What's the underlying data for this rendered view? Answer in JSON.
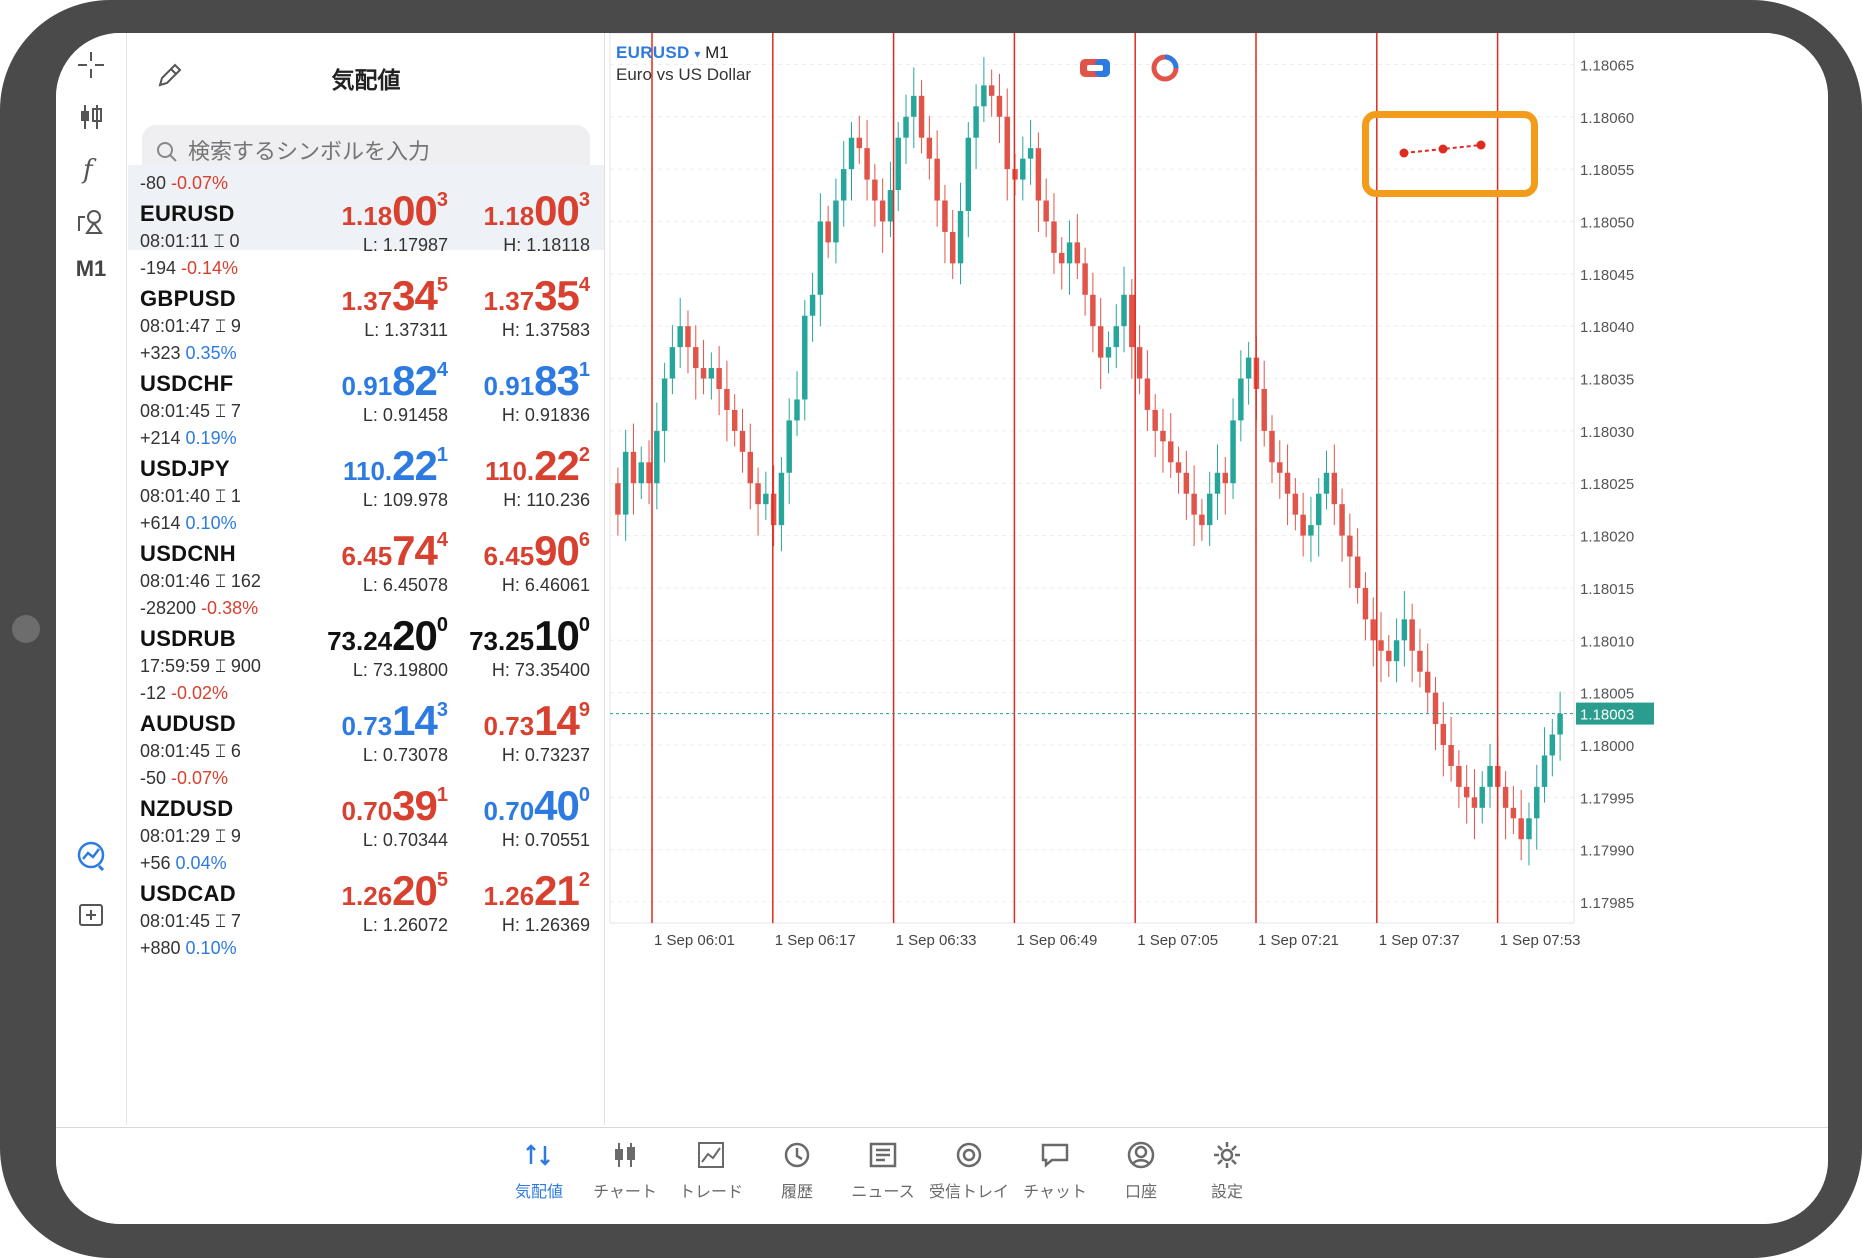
{
  "quotes": {
    "title": "気配値",
    "search_placeholder": "検索するシンボルを入力",
    "rows": [
      {
        "change": "-80",
        "pct": "-0.07%",
        "pct_color": "red",
        "symbol": "EURUSD",
        "time": "08:01:11",
        "spread": "0",
        "bid": {
          "a": "1.18",
          "b": "00",
          "c": "3",
          "color": "red"
        },
        "ask": {
          "a": "1.18",
          "b": "00",
          "c": "3",
          "color": "red"
        },
        "low": "L: 1.17987",
        "high": "H: 1.18118",
        "selected": true
      },
      {
        "change": "-194",
        "pct": "-0.14%",
        "pct_color": "red",
        "symbol": "GBPUSD",
        "time": "08:01:47",
        "spread": "9",
        "bid": {
          "a": "1.37",
          "b": "34",
          "c": "5",
          "color": "red"
        },
        "ask": {
          "a": "1.37",
          "b": "35",
          "c": "4",
          "color": "red"
        },
        "low": "L: 1.37311",
        "high": "H: 1.37583"
      },
      {
        "change": "+323",
        "pct": "0.35%",
        "pct_color": "blue",
        "symbol": "USDCHF",
        "time": "08:01:45",
        "spread": "7",
        "bid": {
          "a": "0.91",
          "b": "82",
          "c": "4",
          "color": "blue"
        },
        "ask": {
          "a": "0.91",
          "b": "83",
          "c": "1",
          "color": "blue"
        },
        "low": "L: 0.91458",
        "high": "H: 0.91836"
      },
      {
        "change": "+214",
        "pct": "0.19%",
        "pct_color": "blue",
        "symbol": "USDJPY",
        "time": "08:01:40",
        "spread": "1",
        "bid": {
          "a": "110.",
          "b": "22",
          "c": "1",
          "color": "blue"
        },
        "ask": {
          "a": "110.",
          "b": "22",
          "c": "2",
          "color": "red"
        },
        "low": "L: 109.978",
        "high": "H: 110.236"
      },
      {
        "change": "+614",
        "pct": "0.10%",
        "pct_color": "blue",
        "symbol": "USDCNH",
        "time": "08:01:46",
        "spread": "162",
        "bid": {
          "a": "6.45",
          "b": "74",
          "c": "4",
          "color": "red"
        },
        "ask": {
          "a": "6.45",
          "b": "90",
          "c": "6",
          "color": "red"
        },
        "low": "L: 6.45078",
        "high": "H: 6.46061"
      },
      {
        "change": "-28200",
        "pct": "-0.38%",
        "pct_color": "red",
        "symbol": "USDRUB",
        "time": "17:59:59",
        "spread": "900",
        "bid": {
          "a": "73.24",
          "b": "20",
          "c": "0",
          "color": "black"
        },
        "ask": {
          "a": "73.25",
          "b": "10",
          "c": "0",
          "color": "black"
        },
        "low": "L: 73.19800",
        "high": "H: 73.35400"
      },
      {
        "change": "-12",
        "pct": "-0.02%",
        "pct_color": "red",
        "symbol": "AUDUSD",
        "time": "08:01:45",
        "spread": "6",
        "bid": {
          "a": "0.73",
          "b": "14",
          "c": "3",
          "color": "blue"
        },
        "ask": {
          "a": "0.73",
          "b": "14",
          "c": "9",
          "color": "red"
        },
        "low": "L: 0.73078",
        "high": "H: 0.73237"
      },
      {
        "change": "-50",
        "pct": "-0.07%",
        "pct_color": "red",
        "symbol": "NZDUSD",
        "time": "08:01:29",
        "spread": "9",
        "bid": {
          "a": "0.70",
          "b": "39",
          "c": "1",
          "color": "red"
        },
        "ask": {
          "a": "0.70",
          "b": "40",
          "c": "0",
          "color": "blue"
        },
        "low": "L: 0.70344",
        "high": "H: 0.70551"
      },
      {
        "change": "+56",
        "pct": "0.04%",
        "pct_color": "blue",
        "symbol": "USDCAD",
        "time": "08:01:45",
        "spread": "7",
        "bid": {
          "a": "1.26",
          "b": "20",
          "c": "5",
          "color": "red"
        },
        "ask": {
          "a": "1.26",
          "b": "21",
          "c": "2",
          "color": "red"
        },
        "low": "L: 1.26072",
        "high": "H: 1.26369"
      }
    ],
    "partial_next": {
      "change": "+880",
      "pct": "0.10%"
    }
  },
  "toolbar": {
    "timeframe_label": "M1",
    "icons": [
      "crosshair-icon",
      "candlestick-icon",
      "function-icon",
      "shapes-icon",
      "trend-icon",
      "add-window-icon"
    ]
  },
  "chart": {
    "symbol": "EURUSD",
    "dropdown_glyph": "▾",
    "timeframe": "M1",
    "description": "Euro vs US Dollar",
    "price_labels": [
      "1.18065",
      "1.18060",
      "1.18055",
      "1.18050",
      "1.18045",
      "1.18040",
      "1.18035",
      "1.18030",
      "1.18025",
      "1.18020",
      "1.18015",
      "1.18010",
      "1.18005",
      "1.18000",
      "1.17995",
      "1.17990",
      "1.17985"
    ],
    "current_price": "1.18003",
    "time_labels": [
      "1 Sep 06:01",
      "1 Sep 06:17",
      "1 Sep 06:33",
      "1 Sep 06:49",
      "1 Sep 07:05",
      "1 Sep 07:21",
      "1 Sep 07:37",
      "1 Sep 07:53"
    ],
    "colors": {
      "bull": "#26a69a",
      "bear": "#e0544a",
      "vline": "#e02b20",
      "highlight": "#f39b1a",
      "current": "#2a9d8f"
    }
  },
  "chart_data": {
    "type": "candlestick",
    "title": "EURUSD",
    "subtitle": "Euro vs US Dollar",
    "xlabel": "",
    "ylabel": "",
    "ylim": [
      1.17983,
      1.18068
    ],
    "close": [
      1.18022,
      1.18028,
      1.18025,
      1.18027,
      1.18025,
      1.1803,
      1.18035,
      1.18038,
      1.1804,
      1.18038,
      1.18036,
      1.18035,
      1.18036,
      1.18034,
      1.18032,
      1.1803,
      1.18028,
      1.18025,
      1.18023,
      1.18024,
      1.18021,
      1.18026,
      1.18031,
      1.18033,
      1.18041,
      1.18043,
      1.1805,
      1.18048,
      1.18052,
      1.18055,
      1.18058,
      1.18057,
      1.18054,
      1.18052,
      1.1805,
      1.18053,
      1.18058,
      1.1806,
      1.18062,
      1.18058,
      1.18056,
      1.18052,
      1.18049,
      1.18046,
      1.18051,
      1.18058,
      1.18061,
      1.18063,
      1.18062,
      1.1806,
      1.18055,
      1.18054,
      1.18056,
      1.18057,
      1.18052,
      1.1805,
      1.18047,
      1.18046,
      1.18048,
      1.18046,
      1.18043,
      1.1804,
      1.18037,
      1.18038,
      1.1804,
      1.18043,
      1.18038,
      1.18035,
      1.18032,
      1.1803,
      1.18029,
      1.18027,
      1.18026,
      1.18024,
      1.18022,
      1.18021,
      1.18024,
      1.18026,
      1.18025,
      1.18031,
      1.18035,
      1.18037,
      1.18034,
      1.1803,
      1.18027,
      1.18026,
      1.18024,
      1.18022,
      1.1802,
      1.18021,
      1.18024,
      1.18026,
      1.18023,
      1.1802,
      1.18018,
      1.18015,
      1.18012,
      1.1801,
      1.18009,
      1.18008,
      1.1801,
      1.18012,
      1.18009,
      1.18007,
      1.18005,
      1.18002,
      1.18,
      1.17998,
      1.17996,
      1.17995,
      1.17994,
      1.17996,
      1.17998,
      1.17996,
      1.17994,
      1.17993,
      1.17991,
      1.17993,
      1.17996,
      1.17999,
      1.18001,
      1.18003
    ],
    "vertical_markers_at": [
      "1 Sep 06:01",
      "1 Sep 06:17",
      "1 Sep 06:33",
      "1 Sep 06:49",
      "1 Sep 07:05",
      "1 Sep 07:21",
      "1 Sep 07:37",
      "1 Sep 07:53"
    ]
  },
  "bottom_nav": [
    {
      "label": "気配値",
      "icon": "quotes-icon",
      "active": true
    },
    {
      "label": "チャート",
      "icon": "chart-icon"
    },
    {
      "label": "トレード",
      "icon": "trade-icon"
    },
    {
      "label": "履歴",
      "icon": "history-icon"
    },
    {
      "label": "ニュース",
      "icon": "news-icon"
    },
    {
      "label": "受信トレイ",
      "icon": "mailbox-icon"
    },
    {
      "label": "チャット",
      "icon": "chat-icon"
    },
    {
      "label": "口座",
      "icon": "account-icon"
    },
    {
      "label": "設定",
      "icon": "settings-icon"
    }
  ]
}
